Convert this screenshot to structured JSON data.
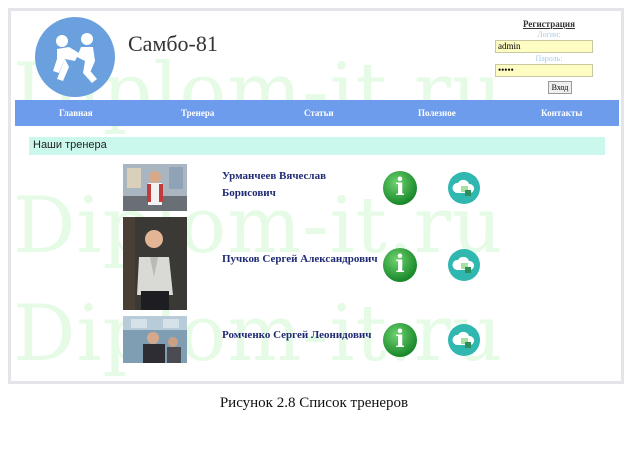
{
  "watermark": "Diplom-it.ru",
  "header": {
    "site_title": "Самбо-81"
  },
  "login": {
    "register_label": "Регистрация",
    "login_label": "Логин:",
    "login_value": "admin",
    "password_label": "Пароль:",
    "password_value": "•••••",
    "submit_label": "Вход"
  },
  "nav": {
    "items": [
      {
        "label": "Главная"
      },
      {
        "label": "Тренера"
      },
      {
        "label": "Статьи"
      },
      {
        "label": "Полезное"
      },
      {
        "label": "Контакты"
      }
    ]
  },
  "section": {
    "title": "Наши тренера"
  },
  "coaches": [
    {
      "name": "Урманчеев Вячеслав Борисович"
    },
    {
      "name": "Пучков Сергей Александрович"
    },
    {
      "name": "Ромченко Сергей Леонидович"
    }
  ],
  "icons": {
    "info": "i"
  },
  "caption": "Рисунок 2.8 Список тренеров",
  "colors": {
    "nav": "#6e9cec",
    "section_bar": "#cbf8ec",
    "logo": "#6aa0dd",
    "watermark": "#e6fbe6"
  }
}
